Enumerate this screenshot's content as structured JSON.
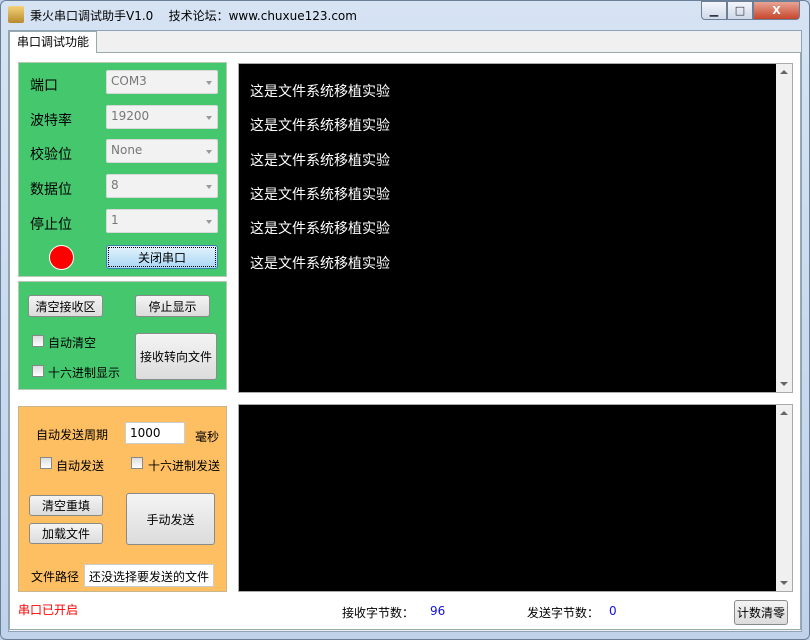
{
  "window": {
    "title": "秉火串口调试助手V1.0",
    "forum": "技术论坛：www.chuxue123.com",
    "minimize": "▁",
    "maximize": "□",
    "close": "X"
  },
  "tab": {
    "label": "串口调试功能"
  },
  "serial": {
    "fields": [
      {
        "label": "端口",
        "value": "COM3"
      },
      {
        "label": "波特率",
        "value": "19200"
      },
      {
        "label": "校验位",
        "value": "None"
      },
      {
        "label": "数据位",
        "value": "8"
      },
      {
        "label": "停止位",
        "value": "1"
      }
    ],
    "status_color": "#ff0000",
    "toggle_label": "关闭串口"
  },
  "receive": {
    "clear_label": "清空接收区",
    "stop_label": "停止显示",
    "auto_clear_label": "自动清空",
    "hex_display_label": "十六进制显示",
    "to_file_label": "接收转向文件",
    "lines": [
      "这是文件系统移植实验",
      "这是文件系统移植实验",
      "这是文件系统移植实验",
      "这是文件系统移植实验",
      "这是文件系统移植实验",
      "这是文件系统移植实验"
    ]
  },
  "send": {
    "period_label": "自动发送周期",
    "period_value": "1000",
    "period_unit": "毫秒",
    "auto_send_label": "自动发送",
    "hex_send_label": "十六进制发送",
    "clear_label": "清空重填",
    "load_label": "加载文件",
    "manual_label": "手动发送",
    "path_label": "文件路径",
    "path_value": "还没选择要发送的文件"
  },
  "status": {
    "port_state": "串口已开启",
    "rx_label": "接收字节数：",
    "rx_value": "96",
    "tx_label": "发送字节数：",
    "tx_value": "0",
    "reset_label": "计数清零"
  }
}
